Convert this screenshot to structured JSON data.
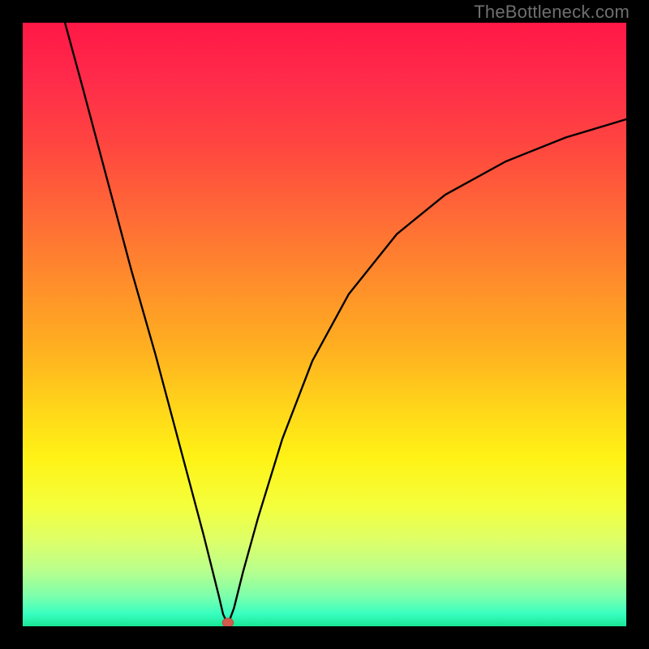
{
  "watermark": "TheBottleneck.com",
  "chart_data": {
    "type": "line",
    "title": "",
    "xlabel": "",
    "ylabel": "",
    "xlim": [
      0,
      100
    ],
    "ylim": [
      0,
      100
    ],
    "gradient_stops": [
      {
        "pct": 0,
        "color": "#ff1846"
      },
      {
        "pct": 9,
        "color": "#ff2a4a"
      },
      {
        "pct": 20,
        "color": "#ff4540"
      },
      {
        "pct": 32,
        "color": "#ff6a36"
      },
      {
        "pct": 42,
        "color": "#ff8a2c"
      },
      {
        "pct": 54,
        "color": "#ffb020"
      },
      {
        "pct": 64,
        "color": "#ffd61a"
      },
      {
        "pct": 72,
        "color": "#fff215"
      },
      {
        "pct": 80,
        "color": "#f4ff3c"
      },
      {
        "pct": 86,
        "color": "#dcff6a"
      },
      {
        "pct": 91,
        "color": "#b6ff8e"
      },
      {
        "pct": 95,
        "color": "#7cffab"
      },
      {
        "pct": 98,
        "color": "#37ffc0"
      },
      {
        "pct": 100,
        "color": "#18e593"
      }
    ],
    "marker": {
      "x": 34,
      "y": 0.5,
      "color": "#d35a4c",
      "r": 1.0
    },
    "series": [
      {
        "name": "curve",
        "x": [
          7,
          10,
          14,
          18,
          22,
          26,
          30,
          31.5,
          32.5,
          33.2,
          34,
          35,
          36.5,
          39,
          43,
          48,
          54,
          62,
          70,
          80,
          90,
          100
        ],
        "y": [
          100,
          89,
          74,
          59,
          45,
          30,
          15,
          9,
          5,
          2,
          0.3,
          3,
          9,
          18,
          31,
          44,
          55,
          65,
          71.5,
          77,
          81,
          84
        ]
      }
    ]
  }
}
